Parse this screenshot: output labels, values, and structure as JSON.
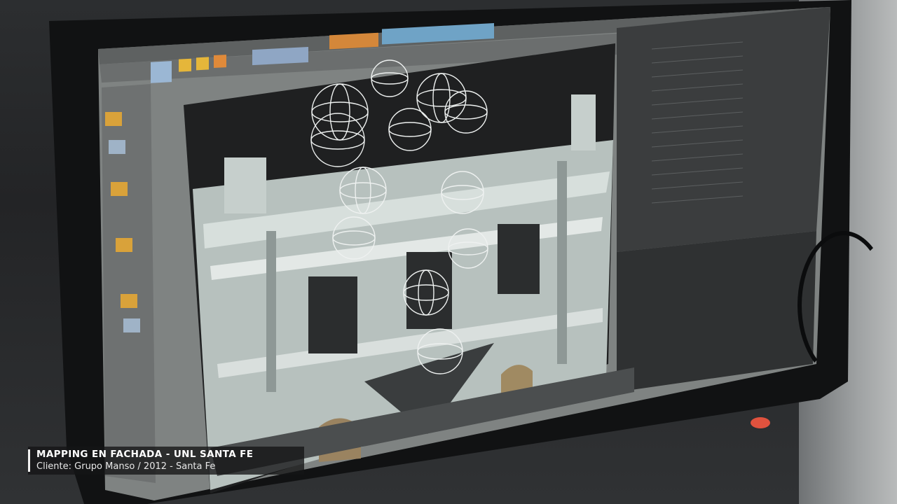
{
  "caption": {
    "title": "MAPPING EN FACHADA - UNL SANTA FE",
    "subtitle": "Cliente: Grupo Manso  / 2012 - Santa Fe"
  },
  "colors": {
    "screen_bg": "#8a8d8c",
    "viewport_dark": "#1e1f20",
    "facade_light": "#c9d2cf",
    "panel_dark": "#3a3c3d",
    "power_led": "#e0523e"
  },
  "icons": [
    "light-gizmo-icon",
    "toolbar-icon",
    "power-led-icon"
  ]
}
